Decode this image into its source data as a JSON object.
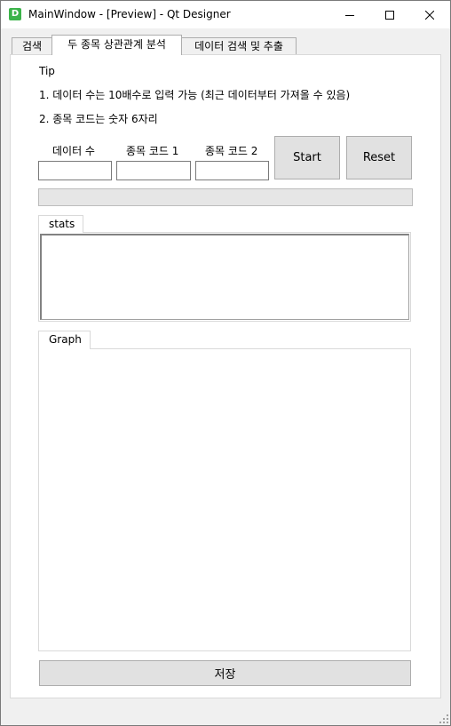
{
  "window": {
    "icon_letter": "D",
    "title": "MainWindow - [Preview] - Qt Designer",
    "controls": {
      "minimize": "minimize-icon",
      "maximize": "maximize-icon",
      "close": "close-icon"
    }
  },
  "tabs": [
    {
      "label": "검색",
      "active": false
    },
    {
      "label": "두 종목 상관관계 분석",
      "active": true
    },
    {
      "label": "데이터 검색 및 추출",
      "active": false
    }
  ],
  "tip": {
    "title": "Tip",
    "line1": "1. 데이터 수는 10배수로 입력 가능 (최근 데이터부터 가져올 수 있음)",
    "line2": "2. 종목 코드는 숫자 6자리"
  },
  "inputs": {
    "data_count_label": "데이터 수",
    "data_count_value": "",
    "code1_label": "종목 코드 1",
    "code1_value": "",
    "code2_label": "종목 코드 2",
    "code2_value": ""
  },
  "buttons": {
    "start": "Start",
    "reset": "Reset",
    "save": "저장"
  },
  "progress": {
    "value": 0
  },
  "stats": {
    "tab_label": "stats",
    "content": ""
  },
  "graph": {
    "tab_label": "Graph"
  }
}
